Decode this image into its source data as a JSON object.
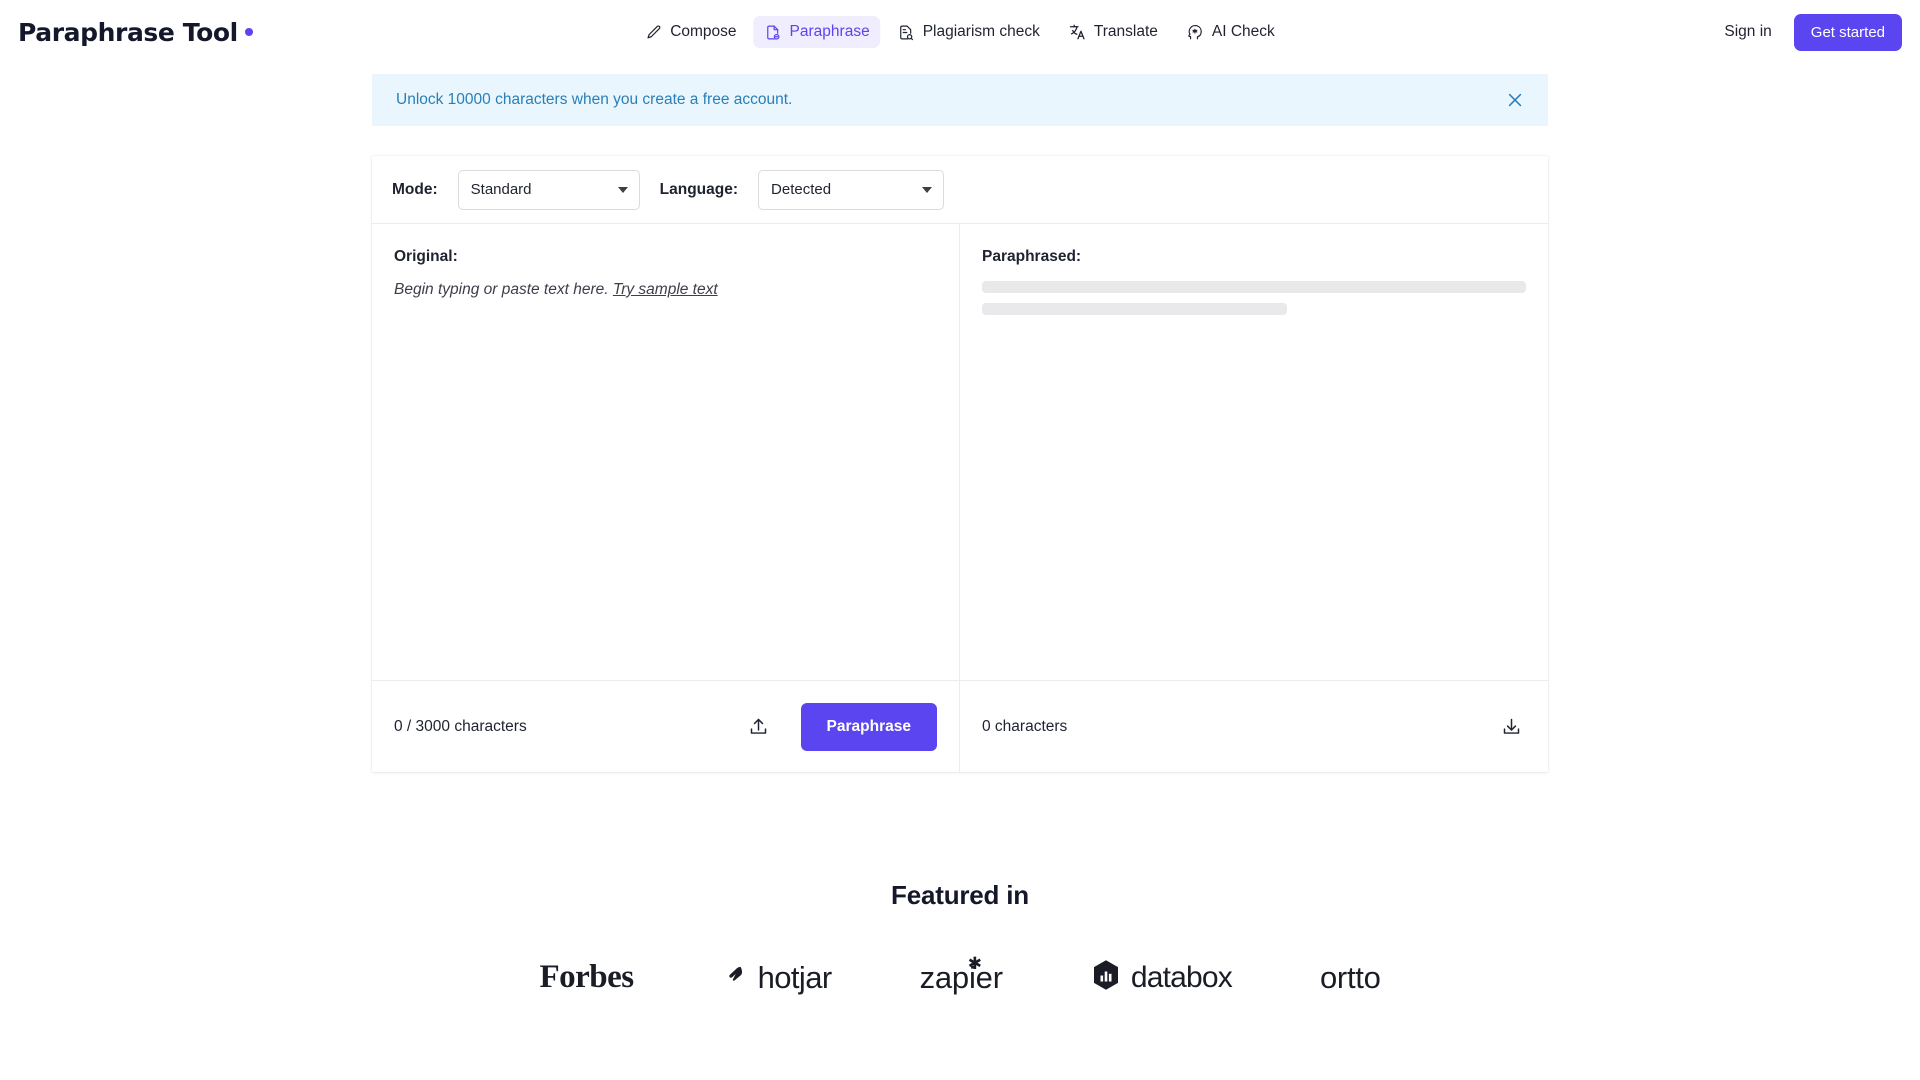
{
  "brand": {
    "name": "Paraphrase Tool",
    "accent_color": "#5b45f0"
  },
  "nav": {
    "items": [
      {
        "label": "Compose",
        "icon": "pencil-icon",
        "active": false
      },
      {
        "label": "Paraphrase",
        "icon": "document-paraphrase-icon",
        "active": true
      },
      {
        "label": "Plagiarism check",
        "icon": "document-search-icon",
        "active": false
      },
      {
        "label": "Translate",
        "icon": "translate-icon",
        "active": false
      },
      {
        "label": "AI Check",
        "icon": "ai-head-icon",
        "active": false
      }
    ],
    "sign_in_label": "Sign in",
    "get_started_label": "Get started"
  },
  "banner": {
    "message": "Unlock 10000 characters when you create a free account.",
    "close_icon": "close-icon",
    "background_color": "#eaf6fd",
    "text_color": "#2a7fb6"
  },
  "controls": {
    "mode_label": "Mode:",
    "mode_value": "Standard",
    "language_label": "Language:",
    "language_value": "Detected"
  },
  "editor": {
    "original_title": "Original:",
    "original_placeholder": "Begin typing or paste text here.",
    "sample_link_label": "Try sample text",
    "original_value": "",
    "paraphrased_title": "Paraphrased:",
    "paraphrased_value": "",
    "input_count": "0 / 3000 characters",
    "output_count": "0 characters",
    "upload_icon": "upload-icon",
    "download_icon": "download-icon",
    "paraphrase_button_label": "Paraphrase"
  },
  "featured": {
    "title": "Featured in",
    "brands": [
      {
        "name": "Forbes"
      },
      {
        "name": "hotjar"
      },
      {
        "name": "zapier"
      },
      {
        "name": "databox"
      },
      {
        "name": "ortto"
      }
    ]
  }
}
